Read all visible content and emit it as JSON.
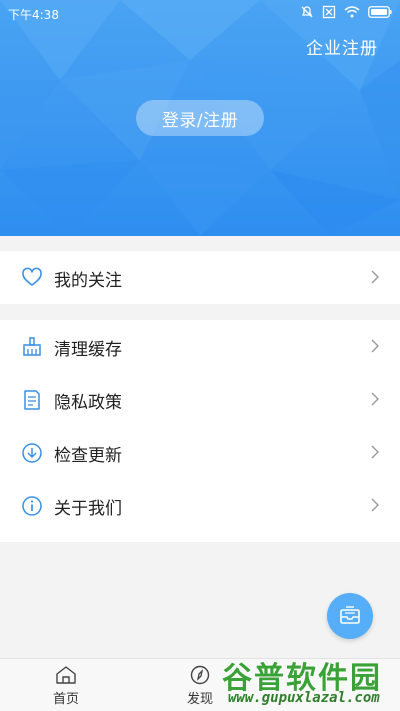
{
  "status_bar": {
    "time": "下午4:38"
  },
  "header": {
    "corp_register_label": "企业注册",
    "login_label": "登录/注册"
  },
  "menu_group_1": [
    {
      "label": "我的关注",
      "icon": "heart-icon"
    }
  ],
  "menu_group_2": [
    {
      "label": "清理缓存",
      "icon": "broom-icon"
    },
    {
      "label": "隐私政策",
      "icon": "document-icon"
    },
    {
      "label": "检查更新",
      "icon": "download-icon"
    },
    {
      "label": "关于我们",
      "icon": "info-icon"
    }
  ],
  "tabs": [
    {
      "label": "首页",
      "icon": "home-icon"
    },
    {
      "label": "发现",
      "icon": "compass-icon"
    }
  ],
  "watermark": {
    "title": "谷普软件园",
    "url": "www.gupuxlazal.com"
  },
  "colors": {
    "primary": "#3b97f1",
    "icon_blue": "#3a8fe6",
    "fab": "#55aef7"
  }
}
